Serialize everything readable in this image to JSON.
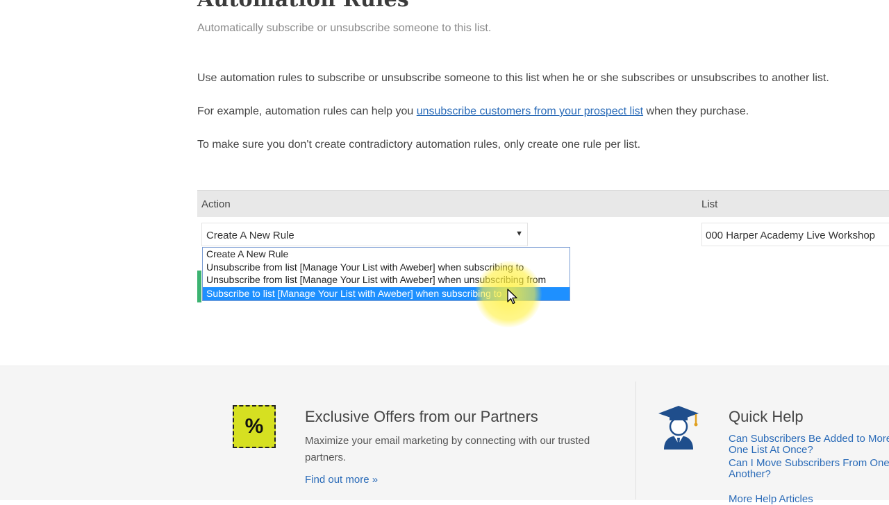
{
  "page": {
    "title": "Automation Rules",
    "subtitle": "Automatically subscribe or unsubscribe someone to this list."
  },
  "intro": {
    "line1": "Use automation rules to subscribe or unsubscribe someone to this list when he or she subscribes or unsubscribes to another list.",
    "line2_before": "For example, automation rules can help you ",
    "line2_link": "unsubscribe customers from your prospect list",
    "line2_after": " when they purchase.",
    "line3": "To make sure you don't create contradictory automation rules, only create one rule per list."
  },
  "rules_table": {
    "col_action": "Action",
    "col_list": "List",
    "action_selected": "Create A New Rule",
    "action_caret": "▼",
    "list_selected": "000 Harper Academy Live Workshop",
    "options": [
      "Create A New Rule",
      "Unsubscribe from list [Manage Your List with Aweber] when subscribing to",
      "Unsubscribe from list [Manage Your List with Aweber] when unsubscribing from",
      "Subscribe to list [Manage Your List with Aweber] when subscribing to"
    ],
    "highlighted_index": 3
  },
  "offers": {
    "icon": "percent-icon",
    "icon_glyph": "%",
    "title": "Exclusive Offers from our Partners",
    "text": "Maximize your email marketing by connecting with our trusted partners.",
    "link": "Find out more »"
  },
  "quick_help": {
    "icon": "graduate-icon",
    "title": "Quick Help",
    "links": [
      "Can Subscribers Be Added to More\nOne List At Once?",
      "Can I Move Subscribers From One L\nAnother?",
      "More Help Articles"
    ]
  },
  "colors": {
    "link": "#2a6bb8",
    "selected_option": "#1e90ff",
    "offer_icon_bg": "#d6e021",
    "highlight": "#fff03c",
    "green_accent": "#3cb371"
  }
}
